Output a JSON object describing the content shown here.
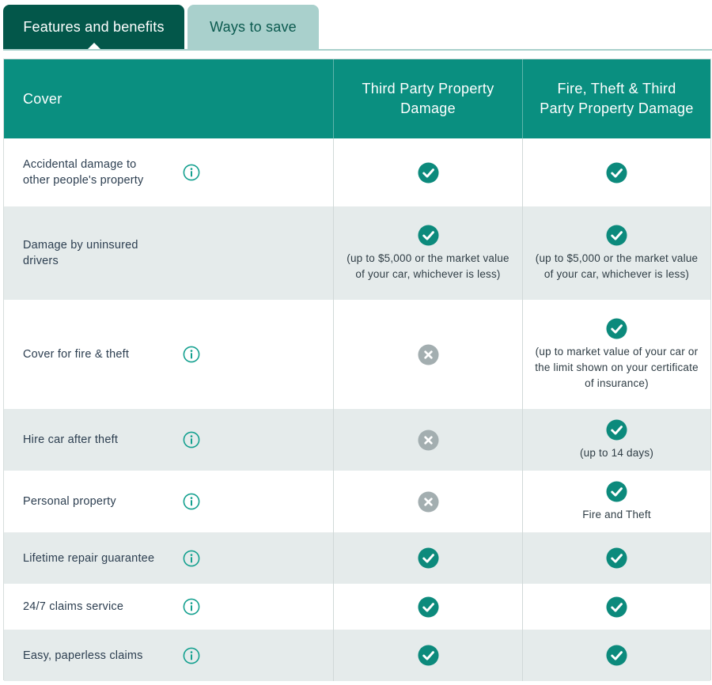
{
  "tabs": {
    "features": "Features and benefits",
    "ways_to_save": "Ways to save"
  },
  "table": {
    "header": {
      "cover": "Cover",
      "col1": "Third Party Property Damage",
      "col2": "Fire, Theft & Third Party Property Damage"
    },
    "rows": [
      {
        "label": "Accidental damage to other people's property",
        "info": true,
        "c1": {
          "icon": "check-icon",
          "note": ""
        },
        "c2": {
          "icon": "check-icon",
          "note": ""
        }
      },
      {
        "label": "Damage by uninsured drivers",
        "info": false,
        "c1": {
          "icon": "check-icon",
          "note": "(up to $5,000 or the market value of your car, whichever is less)"
        },
        "c2": {
          "icon": "check-icon",
          "note": "(up to $5,000 or the market value of your car, whichever is less)"
        }
      },
      {
        "label": "Cover for fire & theft",
        "info": true,
        "c1": {
          "icon": "cross-icon",
          "note": ""
        },
        "c2": {
          "icon": "check-icon",
          "note": "(up to market value of your car or the limit shown on your certificate of insurance)"
        }
      },
      {
        "label": "Hire car after theft",
        "info": true,
        "c1": {
          "icon": "cross-icon",
          "note": ""
        },
        "c2": {
          "icon": "check-icon",
          "note": "(up to 14 days)"
        }
      },
      {
        "label": "Personal property",
        "info": true,
        "c1": {
          "icon": "cross-icon",
          "note": ""
        },
        "c2": {
          "icon": "check-icon",
          "note": "Fire and Theft"
        }
      },
      {
        "label": "Lifetime repair guarantee",
        "info": true,
        "c1": {
          "icon": "check-icon",
          "note": ""
        },
        "c2": {
          "icon": "check-icon",
          "note": ""
        }
      },
      {
        "label": "24/7 claims service",
        "info": true,
        "c1": {
          "icon": "check-icon",
          "note": ""
        },
        "c2": {
          "icon": "check-icon",
          "note": ""
        }
      },
      {
        "label": "Easy, paperless claims",
        "info": true,
        "c1": {
          "icon": "check-icon",
          "note": ""
        },
        "c2": {
          "icon": "check-icon",
          "note": ""
        }
      }
    ]
  },
  "colors": {
    "tab_active": "#03574a",
    "tab_inactive": "#a9d0cc",
    "header_bg": "#0a8f80",
    "check": "#0c8a7c",
    "cross": "#a3aeb0",
    "info": "#14a08f"
  }
}
